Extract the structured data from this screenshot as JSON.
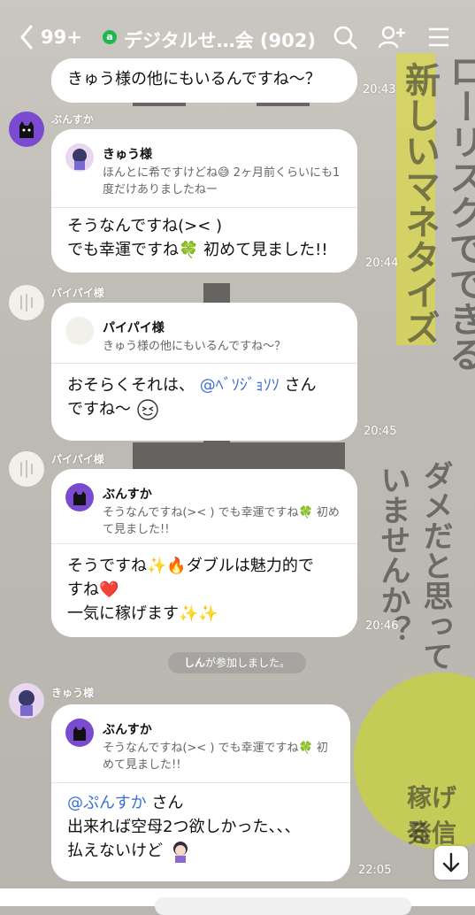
{
  "header": {
    "back_label": "<",
    "unread_count": "99+",
    "group_badge": "a",
    "title": "デジタルせ…会 (902)",
    "icons": [
      "search-icon",
      "add-friend-icon",
      "menu-icon"
    ]
  },
  "messages": [
    {
      "text": "きゅう様の他にもいるんですね～？",
      "time": "20:43"
    },
    {
      "sender": "ぶんすか",
      "quote_name": "きゅう様",
      "quote_text": "ほんとに希ですけどね😅 2ヶ月前くらいにも1度だけありましたねー",
      "line1": "そうなんですね(>< )",
      "line2": "でも幸運ですね🍀 初めて見ました!!",
      "time": "20:44"
    },
    {
      "sender": "パイパイ様",
      "quote_name": "パイパイ様",
      "quote_text": "きゅう様の他にもいるんですね～？",
      "line1_prefix": "おそらくそれは、",
      "mention": "@ﾍﾞｿｼﾞｮｿｿ",
      "line1_suffix": "さん",
      "line2": "ですね～",
      "time": "20:45"
    },
    {
      "sender": "パイパイ様",
      "quote_name": "ぶんすか",
      "quote_text": "そうなんですね(>< ) でも幸運ですね🍀 初めて見ました!!",
      "line1": "そうですね✨🔥ダブルは魅力的で",
      "line2": "すね❤️",
      "line3": "一気に稼げます✨✨",
      "time": "20:46"
    },
    {
      "sender": "きゅう様",
      "quote_name": "ぶんすか",
      "quote_text": "そうなんですね(>< ) でも幸運ですね🍀 初めて見ました!!",
      "mention": "@ぷんすか",
      "mention_suffix": "さん",
      "line2": "出来れば空母2つ欲しかった、、、",
      "line3": "払えないけど",
      "time": "22:05"
    }
  ],
  "system_notice": {
    "name": "しん",
    "text": "が参加しました。"
  },
  "background_text": [
    "ローリスクでできる",
    "新しいマネタイズ",
    "ダメだと思って",
    "いませんか？",
    "稼げる",
    "発信"
  ],
  "colors": {
    "accent_green": "#1db84e",
    "mention_blue": "#3b6fd6",
    "background": "#b9b7b0"
  }
}
